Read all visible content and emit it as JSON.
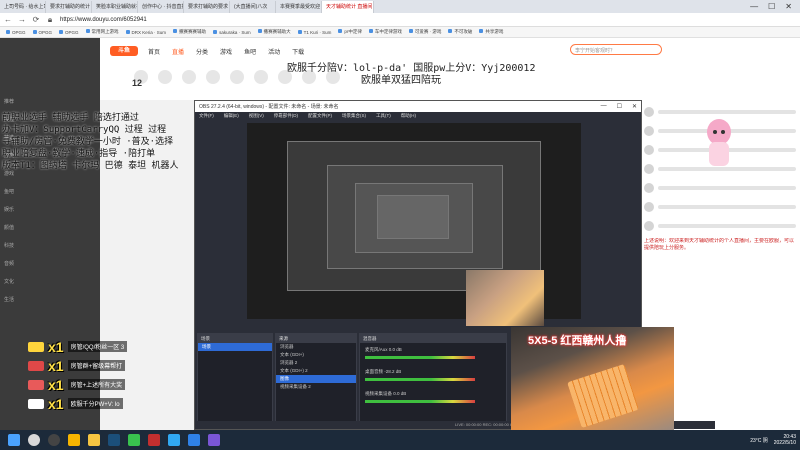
{
  "browser": {
    "tabs": [
      {
        "label": "上司号码 · 给水上司 从这里开始",
        "active": false
      },
      {
        "label": "要求打辅助的统计",
        "active": false
      },
      {
        "label": "笑脸本职业辅助就在",
        "active": false
      },
      {
        "label": "创作中心 · 抖音直播",
        "active": false
      },
      {
        "label": "要求打辅助的要求",
        "active": false
      },
      {
        "label": "(大直播间)八次",
        "active": false
      },
      {
        "label": "本赛赛季最受欢迎",
        "active": false
      },
      {
        "label": "天才辅助统计 直播间",
        "active": true
      }
    ],
    "url": "https://www.douyu.com/6052941",
    "bookmarks": [
      "OPGG",
      "OPGG",
      "OPGG",
      "常用网上游戏",
      "DRX Keria · Sum",
      "撒赛赛赛辅助",
      "sakuraka · Sum",
      "撒赛赛辅助大",
      "T1 Kuri · Sum",
      "pr中定律",
      "车中定律游戏",
      "可爱赛 · 游戏",
      "不可攻破",
      "共享游戏"
    ]
  },
  "douyu": {
    "logo": "斗鱼",
    "nav": [
      "首页",
      "直播",
      "分类",
      "游戏",
      "鱼吧",
      "活动",
      "下载"
    ],
    "search_placeholder": "李宁开始客观时？",
    "room_number": "12",
    "left_menu": [
      "推荐",
      "关注",
      "精选",
      "分类",
      "游戏",
      "鱼吧",
      "娱乐",
      "颜值",
      "科技",
      "音频",
      "文化",
      "生活"
    ],
    "title_line1": "欧服千分陪V：lol-p-da' 国服pw上分V：Yyj200012",
    "title_line2": "欧服单双猛四陪玩",
    "info_lines": [
      "前职业选手 辅助选手 陪选打通过",
      "办卡加V：SupportCarryQQ  过程 过程",
      "寻辅助/房管·免费教学一小时 ·普及·选择",
      "职业陪复盘·教学·速成·指导 ·陪打单",
      "版本T1：图纳塔 卡尔玛 巴德 泰坦 机器人"
    ],
    "gifts": [
      {
        "count": "x1",
        "label": "房管/QQ/粉丝一区 3",
        "color": "#ffd53c"
      },
      {
        "count": "x1",
        "label": "房管群+留级幕帮打",
        "color": "#e04848"
      },
      {
        "count": "x1",
        "label": "房管+上述所有大奖",
        "color": "#e85a5a"
      },
      {
        "count": "x1",
        "label": "欧服千分PW+V: lo",
        "color": "#ffffff"
      }
    ],
    "anchor_notice": "上述说明：欢迎来到天才辅助统计的个人直播间，主要在欧服，可以提供陪玩上分服务。",
    "right_chats": [
      "",
      "",
      "",
      "",
      "",
      "",
      ""
    ]
  },
  "obs": {
    "title": "OBS 27.2.4 (64-bit, windows) - 配置文件: 未命名 - 场景: 未命名",
    "menu": [
      "文件(F)",
      "编辑(E)",
      "视图(V)",
      "停靠部件(D)",
      "配置文件(P)",
      "场景集合(S)",
      "工具(T)",
      "帮助(H)"
    ],
    "docks": {
      "scenes_title": "场景",
      "scenes": [
        "场景"
      ],
      "sources_title": "来源",
      "sources": [
        {
          "label": "浏览器",
          "selected": false
        },
        {
          "label": "文本 (GDI+)",
          "selected": false
        },
        {
          "label": "浏览器 2",
          "selected": false
        },
        {
          "label": "文本 (GDI+) 2",
          "selected": false
        },
        {
          "label": "图像",
          "selected": true
        },
        {
          "label": "视频采集设备 2",
          "selected": false
        }
      ],
      "mixer_title": "混音器",
      "mixer": [
        {
          "label": "麦克风/Aux",
          "db": "0.0 dB"
        },
        {
          "label": "桌面音频",
          "db": "-28.2 dB"
        },
        {
          "label": "视频采集设备",
          "db": "0.0 dB"
        }
      ],
      "transition_title": "转场特效",
      "controls_title": "控制",
      "controls": [
        "开始推流",
        "开始录制",
        "启动虚拟摄像机",
        "工作室模式",
        "设置",
        "退出"
      ],
      "dock_label": "未选择源",
      "status": "LIVE: 00:00:00  REC: 00:00:00  CPU: 1.5%, 60.00 fps"
    }
  },
  "cam_caption": "5X5-5  红西赣州人撸",
  "taskbar": {
    "weather": "23°C 阴",
    "time": "20:43",
    "date": "2022/5/10",
    "icons": [
      {
        "name": "windows-start-icon",
        "color": "#4aa3ff"
      },
      {
        "name": "search-icon",
        "color": "#d8d8d8"
      },
      {
        "name": "obs-icon",
        "color": "#444444"
      },
      {
        "name": "chrome-icon",
        "color": "#f5b400"
      },
      {
        "name": "folder-icon",
        "color": "#f4c542"
      },
      {
        "name": "steam-icon",
        "color": "#1b4f7a"
      },
      {
        "name": "wechat-icon",
        "color": "#39c24e"
      },
      {
        "name": "game-icon",
        "color": "#c22f2f"
      },
      {
        "name": "qq-icon",
        "color": "#31a9f3"
      },
      {
        "name": "browser-icon",
        "color": "#2f82e8"
      },
      {
        "name": "app-icon",
        "color": "#7a56d6"
      }
    ]
  }
}
